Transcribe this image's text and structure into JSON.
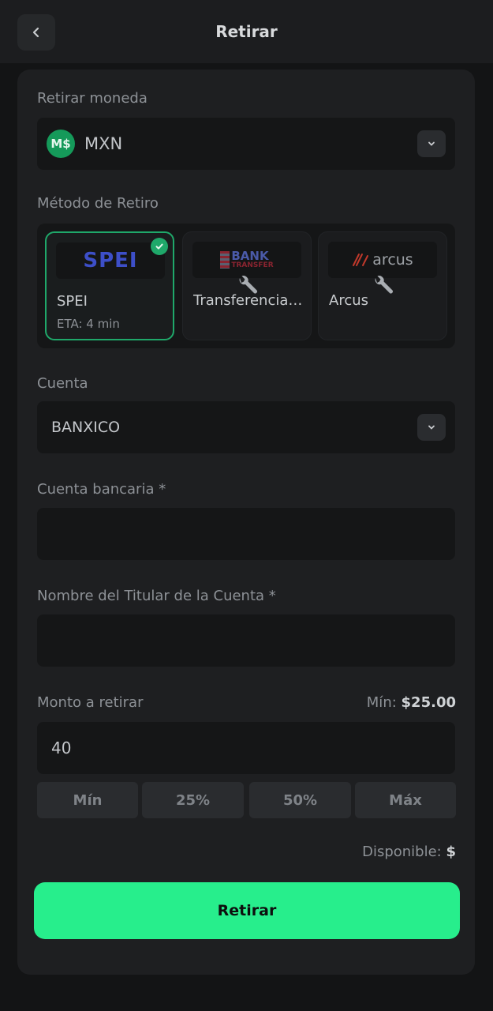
{
  "header": {
    "title": "Retirar"
  },
  "currency": {
    "label": "Retirar moneda",
    "value": "MXN",
    "icon_text": "M$"
  },
  "method": {
    "label": "Método de Retiro",
    "options": [
      {
        "logo": "SPEI",
        "name": "SPEI",
        "eta": "ETA: 4 min"
      },
      {
        "logo_line1": "BANK",
        "logo_line2": "TRANSFER",
        "name": "Transferencia Bancaria"
      },
      {
        "logo": "arcus",
        "name": "Arcus"
      }
    ]
  },
  "account": {
    "label": "Cuenta",
    "value": "BANXICO"
  },
  "bank_account": {
    "label": "Cuenta bancaria *",
    "value": ""
  },
  "holder_name": {
    "label": "Nombre del Titular de la Cuenta *",
    "value": ""
  },
  "amount": {
    "label": "Monto a retirar",
    "min_label": "Mín:",
    "min_value": "$25.00",
    "value": "40",
    "quick": [
      "Mín",
      "25%",
      "50%",
      "Máx"
    ]
  },
  "available": {
    "label": "Disponible:",
    "value": "$"
  },
  "submit_label": "Retirar",
  "colors": {
    "accent": "#27ee8c",
    "selected_border": "#1fa86a"
  }
}
